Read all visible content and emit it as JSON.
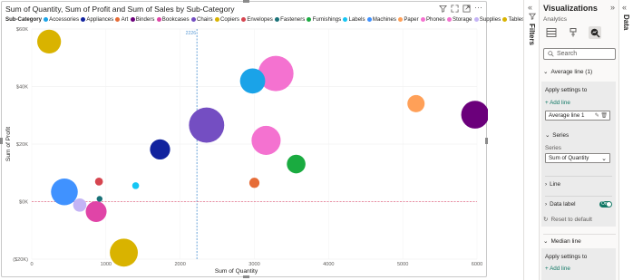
{
  "chart": {
    "title": "Sum of Quantity, Sum of Profit and Sum of Sales by Sub-Category",
    "legend_title": "Sub-Category",
    "x_axis_title": "Sum of Quantity",
    "y_axis_title": "Sum of Profit",
    "avg_line_label": "2226",
    "toolbar_icons": [
      "filter-icon",
      "expand-icon",
      "focus-icon",
      "more-icon"
    ]
  },
  "chart_data": {
    "type": "scatter",
    "title": "Sum of Quantity, Sum of Profit and Sum of Sales by Sub-Category",
    "xlabel": "Sum of Quantity",
    "ylabel": "Sum of Profit",
    "xlim": [
      0,
      6000
    ],
    "ylim": [
      -20000,
      60000
    ],
    "x_ticks": [
      "0",
      "1000",
      "2000",
      "3000",
      "4000",
      "5000",
      "6000"
    ],
    "y_ticks": [
      "$60K",
      "$40K",
      "$20K",
      "$0K",
      "($20K)"
    ],
    "grid": true,
    "reference_lines": [
      {
        "axis": "x",
        "value": 2226,
        "label": "2226",
        "color": "#5b9bd5"
      },
      {
        "axis": "y",
        "value": 0,
        "color": "#e8708a"
      }
    ],
    "series": [
      {
        "name": "Accessories",
        "color": "#1aa3e8",
        "x": 2976,
        "y": 41937,
        "size": 167380
      },
      {
        "name": "Appliances",
        "color": "#12239e",
        "x": 1729,
        "y": 18138,
        "size": 107532
      },
      {
        "name": "Art",
        "color": "#e66c37",
        "x": 3000,
        "y": 6528,
        "size": 27119
      },
      {
        "name": "Binders",
        "color": "#6b007b",
        "x": 5974,
        "y": 30222,
        "size": 203413
      },
      {
        "name": "Bookcases",
        "color": "#e044a7",
        "x": 868,
        "y": -3473,
        "size": 114880
      },
      {
        "name": "Chairs",
        "color": "#744ec2",
        "x": 2356,
        "y": 26590,
        "size": 328449
      },
      {
        "name": "Copiers",
        "color": "#d9b300",
        "x": 234,
        "y": 55618,
        "size": 149528
      },
      {
        "name": "Envelopes",
        "color": "#d64550",
        "x": 906,
        "y": 6964,
        "size": 16476
      },
      {
        "name": "Fasteners",
        "color": "#197278",
        "x": 914,
        "y": 950,
        "size": 3024
      },
      {
        "name": "Furnishings",
        "color": "#1aab40",
        "x": 3563,
        "y": 13059,
        "size": 91705
      },
      {
        "name": "Labels",
        "color": "#15c6f4",
        "x": 1400,
        "y": 5546,
        "size": 12486
      },
      {
        "name": "Machines",
        "color": "#4092ff",
        "x": 440,
        "y": 3385,
        "size": 189239
      },
      {
        "name": "Paper",
        "color": "#ffa058",
        "x": 5178,
        "y": 34054,
        "size": 78479
      },
      {
        "name": "Phones",
        "color": "#f472d0",
        "x": 3289,
        "y": 44516,
        "size": 330007
      },
      {
        "name": "Storage",
        "color": "#f472d0",
        "x": 3158,
        "y": 21279,
        "size": 223844
      },
      {
        "name": "Supplies",
        "color": "#c4b4f5",
        "x": 647,
        "y": -1189,
        "size": 46674
      },
      {
        "name": "Tables",
        "color": "#d9b300",
        "x": 1241,
        "y": -17725,
        "size": 206966
      }
    ]
  },
  "filters_pane": {
    "label": "Filters"
  },
  "data_pane": {
    "label": "Data"
  },
  "vis_pane": {
    "title": "Visualizations",
    "subtitle": "Analytics",
    "search_placeholder": "Search",
    "avg_section": "Average line (1)",
    "apply_settings": "Apply settings to",
    "add_line": "+ Add line",
    "avg_line_name": "Average line 1",
    "series_header": "Series",
    "series_label": "Series",
    "series_value": "Sum of Quantity",
    "line_header": "Line",
    "data_label_header": "Data label",
    "toggle_label": "On",
    "reset": "Reset to default",
    "median_section": "Median line",
    "apply_settings_2": "Apply settings to",
    "add_line_2": "+ Add line"
  }
}
